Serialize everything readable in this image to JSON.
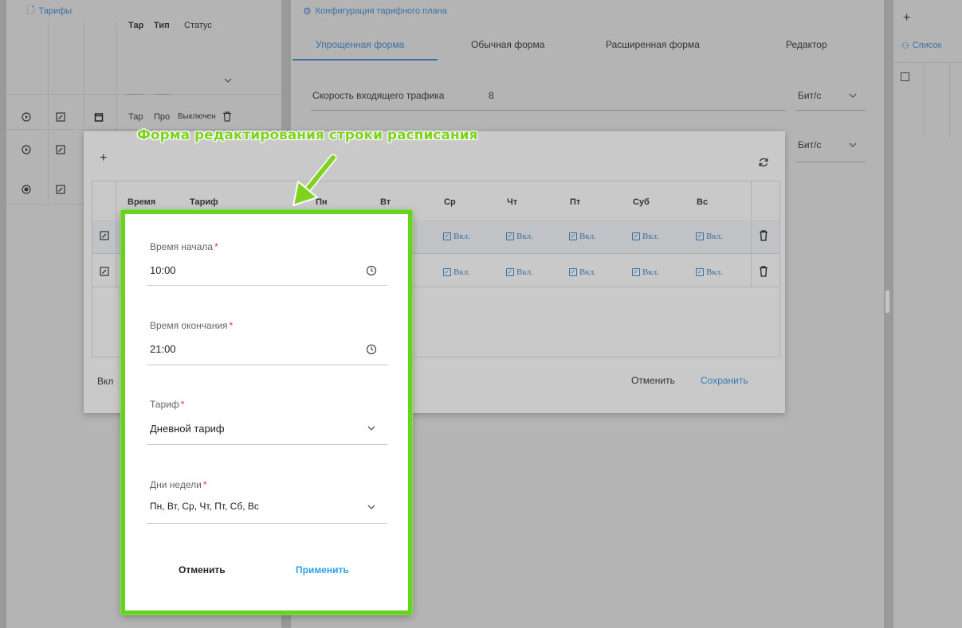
{
  "left_panel": {
    "title": "Тарифы",
    "columns": [
      "Тар",
      "Тип",
      "Статус"
    ],
    "row": {
      "tariff": "Тар",
      "type": "Про",
      "status": "Выключен"
    }
  },
  "middle_panel": {
    "title": "Конфигурация тарифного плана",
    "tabs": [
      "Упрощенная форма",
      "Обычная форма",
      "Расширенная форма",
      "Редактор"
    ],
    "incoming_speed_label": "Скорость входящего трафика",
    "incoming_speed_value": "8",
    "unit": "Бит/с"
  },
  "right_panel": {
    "add_label": "+",
    "list_label": "Список"
  },
  "schedule_dialog": {
    "add_label": "+",
    "columns": [
      "Время",
      "Тариф",
      "Пн",
      "Вт",
      "Ср",
      "Чт",
      "Пт",
      "Суб",
      "Вс"
    ],
    "cell_on": "Вкл.",
    "footer_left": "Вкл",
    "cancel": "Отменить",
    "save": "Сохранить"
  },
  "annotation": {
    "text": "Форма редактирования строки расписания",
    "color": "#7ed321"
  },
  "edit_form": {
    "start_time": {
      "label": "Время начала",
      "value": "10:00"
    },
    "end_time": {
      "label": "Время окончания",
      "value": "21:00"
    },
    "tariff": {
      "label": "Тариф",
      "value": "Дневной тариф"
    },
    "weekdays": {
      "label": "Дни недели",
      "value": "Пн, Вт, Ср, Чт, Пт, Сб, Вс"
    },
    "required_mark": "*",
    "cancel": "Отменить",
    "apply": "Применить",
    "accent": "#29a3e8",
    "border": "#66d41f"
  }
}
